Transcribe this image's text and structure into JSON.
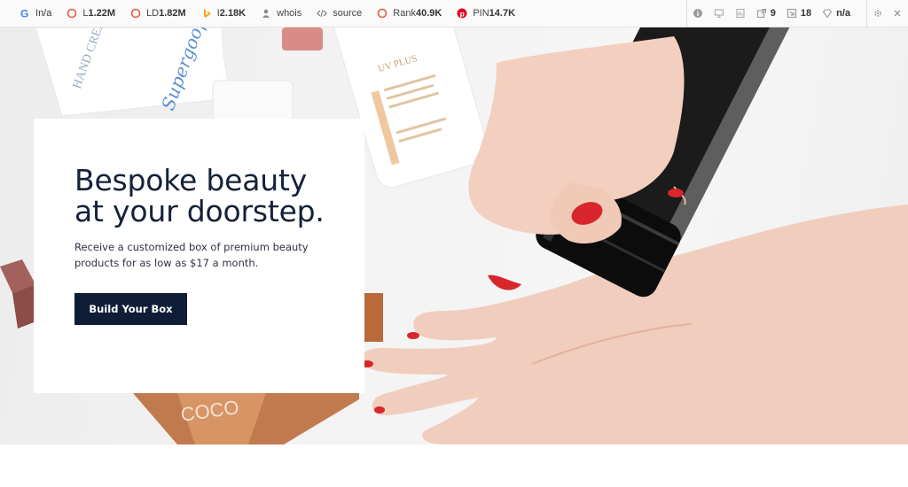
{
  "seo_toolbar": {
    "items": [
      {
        "icon": "google-icon",
        "label": "I",
        "value": "n/a"
      },
      {
        "icon": "link-circle-icon",
        "label": "L",
        "value": "1.22M"
      },
      {
        "icon": "link-circle-icon",
        "label": "LD",
        "value": "1.82M"
      },
      {
        "icon": "bing-icon",
        "label": "I",
        "value": "2.18K"
      },
      {
        "icon": "user-icon",
        "label": "whois",
        "value": ""
      },
      {
        "icon": "code-icon",
        "label": "source",
        "value": ""
      },
      {
        "icon": "rank-circle-icon",
        "label": "Rank",
        "value": "40.9K"
      },
      {
        "icon": "pinterest-icon",
        "label": "PIN",
        "value": "14.7K"
      }
    ],
    "right_items": [
      {
        "icon": "info-icon",
        "value": ""
      },
      {
        "icon": "monitor-icon",
        "value": ""
      },
      {
        "icon": "page-icon",
        "value": ""
      },
      {
        "icon": "external-link-icon",
        "value": "9"
      },
      {
        "icon": "internal-link-icon",
        "value": "18"
      },
      {
        "icon": "diamond-icon",
        "value": "n/a"
      }
    ],
    "colors": {
      "google": "#4285F4",
      "link": "#e0603b",
      "bing": "#f5a623",
      "pinterest": "#e60023"
    }
  },
  "hero": {
    "title": "Bespoke beauty at your doorstep.",
    "subtitle": "Receive a customized box of premium beauty products for as low as $17 a month.",
    "cta_label": "Build Your Box"
  },
  "colors": {
    "navy": "#0f1e36",
    "title": "#142138",
    "nail_red": "#d8262c"
  }
}
